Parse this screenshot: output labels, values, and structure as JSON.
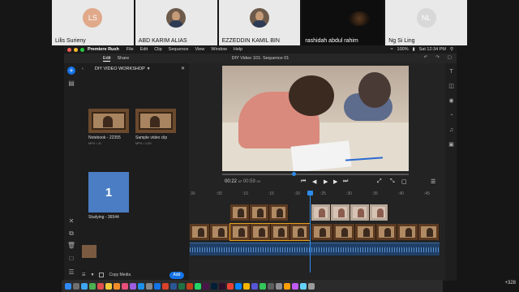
{
  "participants": [
    {
      "name": "Lilis Surieny",
      "initials": "LS",
      "avatar": "initials",
      "color": "#e0a98a"
    },
    {
      "name": "ABD KARIM ALIAS",
      "avatar": "photo"
    },
    {
      "name": "EZZEDDIN KAMIL BIN",
      "avatar": "photo"
    },
    {
      "name": "rashidah abdul rahim",
      "avatar": "video-dark"
    },
    {
      "name": "Ng Si Ling",
      "initials": "NL",
      "avatar": "initials",
      "color": "#d8d8d8"
    }
  ],
  "menubar": {
    "app": "Premiere Rush",
    "items": [
      "File",
      "Edit",
      "Clip",
      "Sequence",
      "View",
      "Window",
      "Help"
    ],
    "battery": "100%",
    "clock": "Sat 12:34 PM"
  },
  "titlebar": {
    "tabs": [
      "Edit",
      "Share"
    ],
    "title": "DIY Video 101: Sequence 01"
  },
  "media_panel": {
    "folder": "DIY VIDEO WORKSHOP",
    "clips": [
      {
        "name": "Notebook - 22355",
        "sub": "MP4 • 11"
      },
      {
        "name": "Sample video clip",
        "sub": "MP4 • 1:00"
      },
      {
        "name": "Studying - 36544",
        "sub": "MP4 • 15"
      }
    ],
    "blue_number": "1",
    "copy_media": "Copy Media",
    "add_button": "Add"
  },
  "transport": {
    "current": "00:22",
    "current_frames": "17",
    "duration": "00:59",
    "duration_frames": "09"
  },
  "ruler_ticks": [
    "30",
    ":05",
    ":10",
    ":15",
    ":20",
    ":25",
    ":30",
    ":35",
    ":40",
    ":45"
  ],
  "overflow_count": "+328",
  "colors": {
    "accent": "#1473e6",
    "playhead": "#2d8ceb",
    "selection": "#e6a21c",
    "audio": "#1f3f66"
  }
}
